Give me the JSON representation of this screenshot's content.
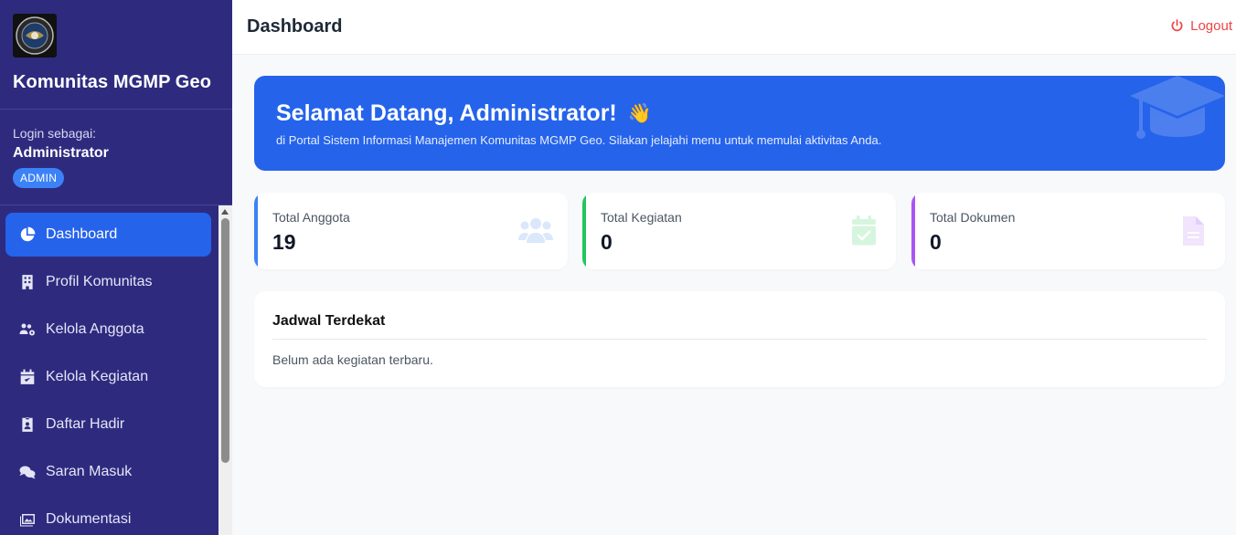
{
  "sidebar": {
    "brand_name": "Komunitas MGMP Geo",
    "login_label": "Login sebagai:",
    "user_name": "Administrator",
    "role": "ADMIN",
    "items": [
      {
        "label": "Dashboard",
        "icon": "pie-chart-icon",
        "active": true
      },
      {
        "label": "Profil Komunitas",
        "icon": "building-icon"
      },
      {
        "label": "Kelola Anggota",
        "icon": "users-gear-icon"
      },
      {
        "label": "Kelola Kegiatan",
        "icon": "calendar-check-icon"
      },
      {
        "label": "Daftar Hadir",
        "icon": "id-badge-icon"
      },
      {
        "label": "Saran Masuk",
        "icon": "comments-icon"
      },
      {
        "label": "Dokumentasi",
        "icon": "images-icon"
      }
    ]
  },
  "header": {
    "title": "Dashboard",
    "logout_label": "Logout"
  },
  "welcome": {
    "title": "Selamat Datang, Administrator!",
    "emoji": "👋",
    "subtitle": "di Portal Sistem Informasi Manajemen Komunitas MGMP Geo. Silakan jelajahi menu untuk memulai aktivitas Anda."
  },
  "stats": [
    {
      "label": "Total Anggota",
      "value": "19",
      "accent": "#3b82f6",
      "icon": "users-icon"
    },
    {
      "label": "Total Kegiatan",
      "value": "0",
      "accent": "#22c55e",
      "icon": "calendar-check-icon"
    },
    {
      "label": "Total Dokumen",
      "value": "0",
      "accent": "#a855f7",
      "icon": "file-icon"
    }
  ],
  "schedule": {
    "title": "Jadwal Terdekat",
    "empty_text": "Belum ada kegiatan terbaru."
  },
  "colors": {
    "sidebar_bg": "#2e2b7f",
    "primary": "#2563eb",
    "logout": "#ef4444"
  }
}
